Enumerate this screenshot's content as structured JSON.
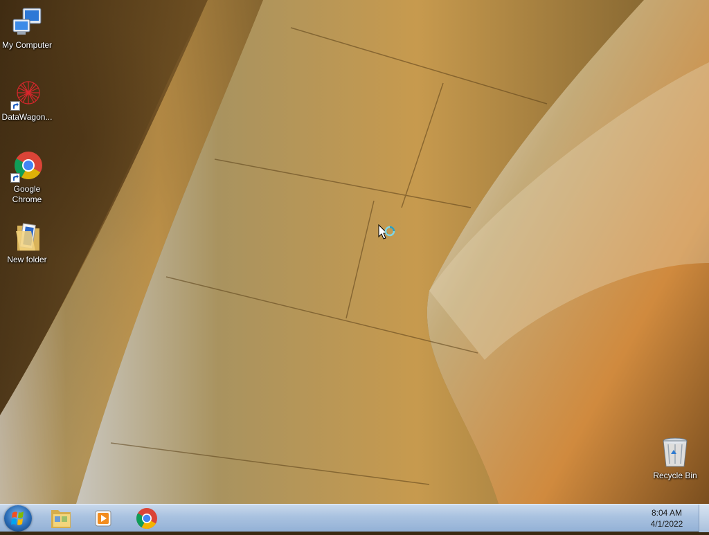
{
  "desktop": {
    "icons": [
      {
        "label": "My Computer",
        "icon": "computer-icon"
      },
      {
        "label": "DataWagon...",
        "icon": "datawagon-icon"
      },
      {
        "label": "Google Chrome",
        "icon": "chrome-icon"
      },
      {
        "label": "New folder",
        "icon": "folder-icon"
      },
      {
        "label": "Recycle Bin",
        "icon": "recycle-bin-icon"
      }
    ]
  },
  "taskbar": {
    "start": "windows-start-icon",
    "pinned": [
      "file-explorer-icon",
      "media-player-icon",
      "chrome-icon"
    ],
    "clock": {
      "time": "8:04 AM",
      "date": "4/1/2022"
    }
  },
  "colors": {
    "taskbar": "#a9c2e0",
    "wallpaper": "#a27a3c"
  }
}
